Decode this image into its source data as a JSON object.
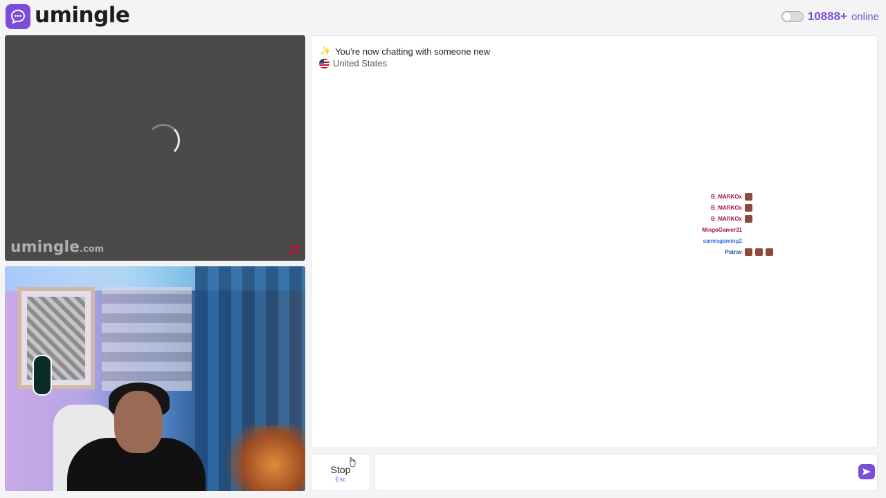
{
  "header": {
    "logo_text": "umingle",
    "online_count": "10888+",
    "online_label": "online"
  },
  "stranger_video": {
    "watermark_brand": "umingle",
    "watermark_domain": ".com"
  },
  "chat": {
    "system_message": "You're now chatting with someone new",
    "country": "United States",
    "overlay": [
      {
        "name": "B_MARKOx",
        "color": "#a0153e",
        "msg": "",
        "emotes": 1
      },
      {
        "name": "B_MARKOx",
        "color": "#a0153e",
        "msg": "",
        "emotes": 1
      },
      {
        "name": "B_MARKOx",
        "color": "#a0153e",
        "msg": "",
        "emotes": 1
      },
      {
        "name": "MingoGamer31",
        "color": "#a0153e",
        "msg": "",
        "emotes": 0
      },
      {
        "name": "samragaming2",
        "color": "#3a6fd1",
        "msg": "",
        "emotes": 0
      },
      {
        "name": "Patrav",
        "color": "#2a52a8",
        "msg": "",
        "emotes": 3
      }
    ]
  },
  "controls": {
    "stop_label": "Stop",
    "stop_hint": "Esc",
    "message_placeholder": ""
  },
  "colors": {
    "accent": "#7b4dd8"
  }
}
